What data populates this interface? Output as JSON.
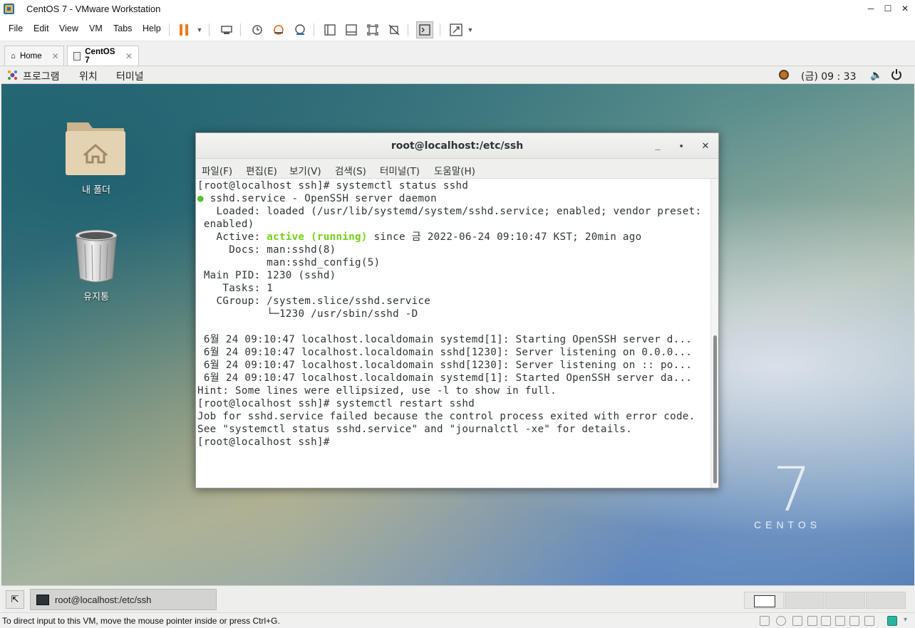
{
  "window": {
    "title": "CentOS 7 - VMware Workstation"
  },
  "menu": {
    "items": [
      "File",
      "Edit",
      "View",
      "VM",
      "Tabs",
      "Help"
    ]
  },
  "tabs": [
    {
      "label": "Home"
    },
    {
      "label": "CentOS 7"
    }
  ],
  "gnome": {
    "menus": [
      "프로그램",
      "위치",
      "터미널"
    ],
    "clock": "(금) 09 : 33"
  },
  "desktop": {
    "icons": [
      {
        "label": "내 폴더",
        "icon": "home-folder-icon"
      },
      {
        "label": "유지통",
        "icon": "trash-icon"
      }
    ],
    "logo_number": "7",
    "logo_text": "CENTOS"
  },
  "terminal": {
    "title": "root@localhost:/etc/ssh",
    "menus": [
      "파일(F)",
      "편집(E)",
      "보기(V)",
      "검색(S)",
      "터미널(T)",
      "도움말(H)"
    ],
    "lines": [
      "[root@localhost ssh]# systemctl status sshd",
      "sshd.service - OpenSSH server daemon",
      "   Loaded: loaded (/usr/lib/systemd/system/sshd.service; enabled; vendor preset:",
      " enabled)",
      "   Active: ",
      "     Docs: man:sshd(8)",
      "           man:sshd_config(5)",
      " Main PID: 1230 (sshd)",
      "    Tasks: 1",
      "   CGroup: /system.slice/sshd.service",
      "           └─1230 /usr/sbin/sshd -D",
      "",
      " 6월 24 09:10:47 localhost.localdomain systemd[1]: Starting OpenSSH server d...",
      " 6월 24 09:10:47 localhost.localdomain sshd[1230]: Server listening on 0.0.0...",
      " 6월 24 09:10:47 localhost.localdomain sshd[1230]: Server listening on :: po...",
      " 6월 24 09:10:47 localhost.localdomain systemd[1]: Started OpenSSH server da...",
      "Hint: Some lines were ellipsized, use -l to show in full.",
      "[root@localhost ssh]# systemctl restart sshd",
      "Job for sshd.service failed because the control process exited with error code.",
      "See \"systemctl status sshd.service\" and \"journalctl -xe\" for details.",
      "[root@localhost ssh]# "
    ],
    "active_status": "active (running)",
    "active_rest": " since 금 2022-06-24 09:10:47 KST; 20min ago",
    "status_dot": "●",
    "status_color": "#4ec02a"
  },
  "taskbar": {
    "item_label": "root@localhost:/etc/ssh"
  },
  "statusbar": {
    "message": "To direct input to this VM, move the mouse pointer inside or press Ctrl+G."
  }
}
